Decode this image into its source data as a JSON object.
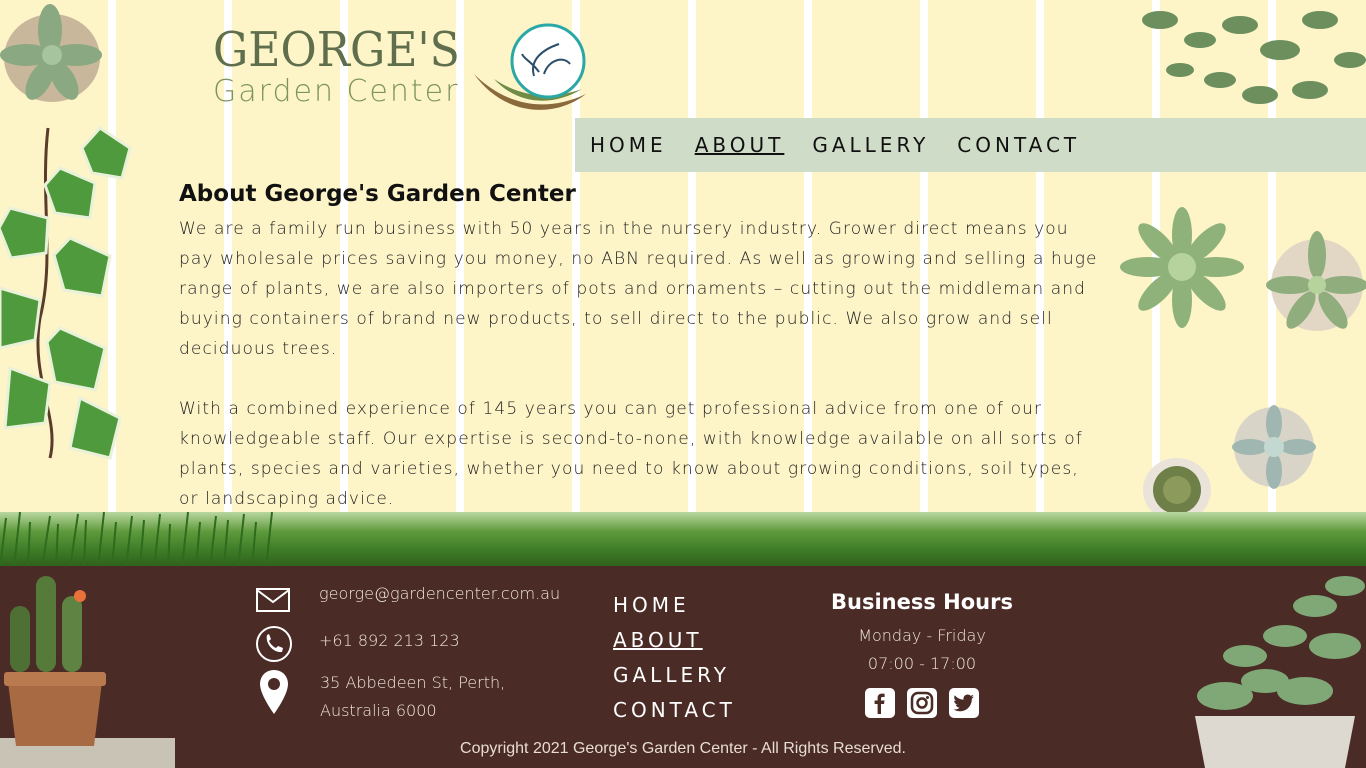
{
  "brand": {
    "name_top": "GEORGE'S",
    "name_bottom": "Garden Center"
  },
  "nav": {
    "items": [
      {
        "label": "HOME"
      },
      {
        "label": "ABOUT"
      },
      {
        "label": "GALLERY"
      },
      {
        "label": "CONTACT"
      }
    ],
    "active": "ABOUT"
  },
  "about": {
    "heading": "About George's Garden Center",
    "paragraph1": "We are a family run business with 50 years in the nursery industry. Grower direct means you pay wholesale prices saving you money, no ABN required. As well as growing and selling a huge range of plants, we are also importers of pots and ornaments – cutting out the middleman and buying containers of brand new products, to sell direct to the public. We also grow and sell deciduous trees.",
    "paragraph2": "With a combined experience of 145 years you can get professional advice from one of our knowledgeable staff. Our expertise is second-to-none, with knowledge available on all sorts of plants, species and varieties, whether you need to know about growing conditions, soil types, or landscaping advice."
  },
  "footer": {
    "email": "george@gardencenter.com.au",
    "phone": "+61 892 213 123",
    "address_line1": "35 Abbedeen St, Perth,",
    "address_line2": "Australia 6000",
    "nav": [
      {
        "label": "HOME"
      },
      {
        "label": "ABOUT"
      },
      {
        "label": "GALLERY"
      },
      {
        "label": "CONTACT"
      }
    ],
    "hours_title": "Business Hours",
    "hours_days": "Monday - Friday",
    "hours_time": "07:00 - 17:00",
    "social_icons": [
      "facebook-icon",
      "instagram-icon",
      "twitter-icon"
    ],
    "copyright": "Copyright 2021 George's Garden Center - All Rights Reserved."
  },
  "colors": {
    "fence_bg": "#fdf4c8",
    "nav_bg": "#cfdcc8",
    "footer_bg": "#4a2b26",
    "brand_green": "#5f6e4c"
  }
}
